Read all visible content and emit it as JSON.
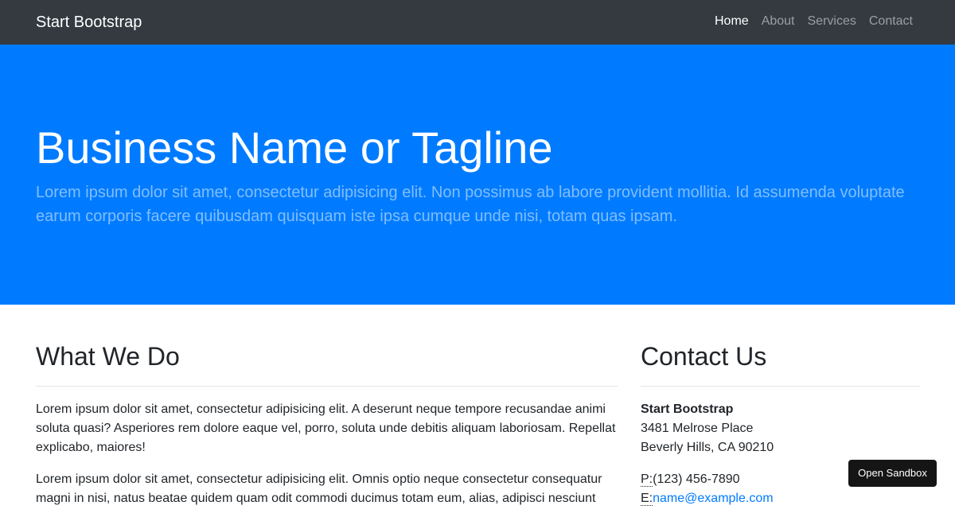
{
  "navbar": {
    "brand": "Start Bootstrap",
    "links": [
      {
        "label": "Home",
        "active": true
      },
      {
        "label": "About",
        "active": false
      },
      {
        "label": "Services",
        "active": false
      },
      {
        "label": "Contact",
        "active": false
      }
    ]
  },
  "hero": {
    "title": "Business Name or Tagline",
    "lead": "Lorem ipsum dolor sit amet, consectetur adipisicing elit. Non possimus ab labore provident mollitia. Id assumenda voluptate earum corporis facere quibusdam quisquam iste ipsa cumque unde nisi, totam quas ipsam."
  },
  "what_we_do": {
    "title": "What We Do",
    "paragraphs": [
      "Lorem ipsum dolor sit amet, consectetur adipisicing elit. A deserunt neque tempore recusandae animi soluta quasi? Asperiores rem dolore eaque vel, porro, soluta unde debitis aliquam laboriosam. Repellat explicabo, maiores!",
      "Lorem ipsum dolor sit amet, consectetur adipisicing elit. Omnis optio neque consectetur consequatur magni in nisi, natus beatae quidem quam odit commodi ducimus totam eum, alias, adipisci nesciunt"
    ]
  },
  "contact": {
    "title": "Contact Us",
    "company": "Start Bootstrap",
    "street": "3481 Melrose Place",
    "city": "Beverly Hills, CA 90210",
    "phone_label": "P:",
    "phone": "(123) 456-7890",
    "email_label": "E:",
    "email": "name@example.com"
  },
  "sandbox_button": "Open Sandbox",
  "colors": {
    "navbar_bg": "#343a40",
    "hero_bg": "#007bff",
    "link": "#007bff",
    "sandbox_bg": "#151515"
  }
}
